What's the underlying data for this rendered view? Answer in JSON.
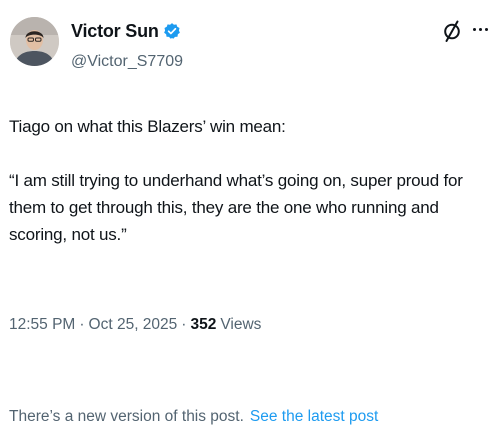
{
  "author": {
    "display_name": "Victor Sun",
    "handle": "@Victor_S7709",
    "verified": true,
    "verified_color": "#1d9bf0"
  },
  "actions": {
    "grok_icon": "grok-icon",
    "more_icon": "more-dots-icon"
  },
  "tweet": {
    "text": "Tiago on what this Blazers’ win mean:\n\n“I am still trying to underhand what’s going on, super proud for them to get through this, they are the one who running and scoring, not us.”"
  },
  "meta": {
    "time": "12:55 PM",
    "separator": "·",
    "date": "Oct 25, 2025",
    "views_count": "352",
    "views_label": "Views"
  },
  "notice": {
    "text": "There’s a new version of this post.",
    "link": "See the latest post",
    "link_color": "#1d9bf0"
  },
  "colors": {
    "primary_text": "#0f1419",
    "secondary_text": "#536471",
    "accent": "#1d9bf0",
    "background": "#ffffff"
  }
}
